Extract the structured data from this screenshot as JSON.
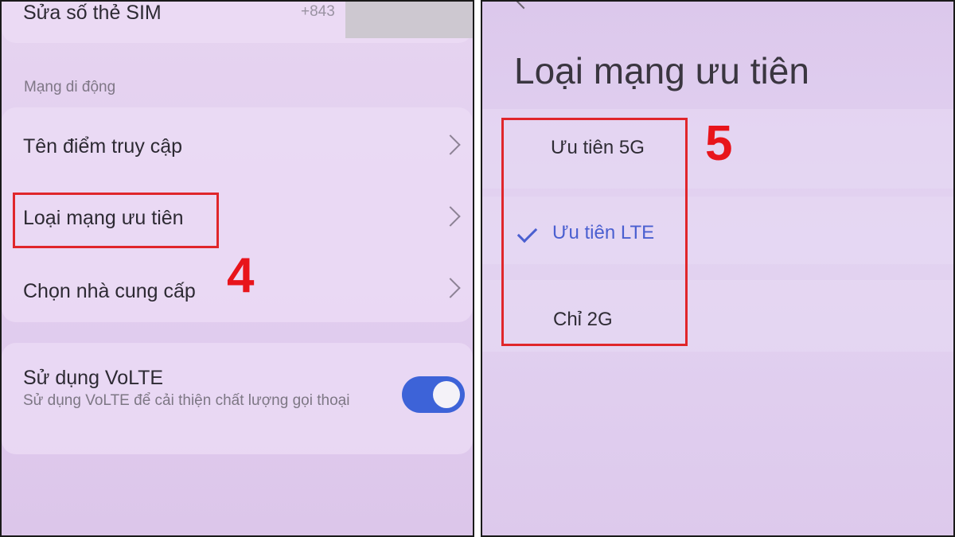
{
  "left": {
    "sim_number_label": "Sửa số thẻ SIM",
    "sim_number_value": "+843",
    "section_title": "Mạng di động",
    "items": [
      {
        "label": "Tên điểm truy cập"
      },
      {
        "label": "Loại mạng ưu tiên"
      },
      {
        "label": "Chọn nhà cung cấp"
      }
    ],
    "volte": {
      "title": "Sử dụng VoLTE",
      "description": "Sử dụng VoLTE để cải thiện chất lượng gọi thoại",
      "enabled": true
    },
    "step_label": "4"
  },
  "right": {
    "title": "Loại mạng ưu tiên",
    "options": [
      {
        "label": "Ưu tiên 5G",
        "selected": false
      },
      {
        "label": "Ưu tiên LTE",
        "selected": true
      },
      {
        "label": "Chỉ 2G",
        "selected": false
      }
    ],
    "step_label": "5"
  },
  "colors": {
    "highlight_box": "#e0262b",
    "step_number": "#e8141b",
    "toggle_on": "#3d63d8",
    "selected_option": "#4a5fd0"
  },
  "icons": {
    "chevron": "chevron-right-icon",
    "check": "check-icon",
    "back": "back-arrow-icon"
  }
}
